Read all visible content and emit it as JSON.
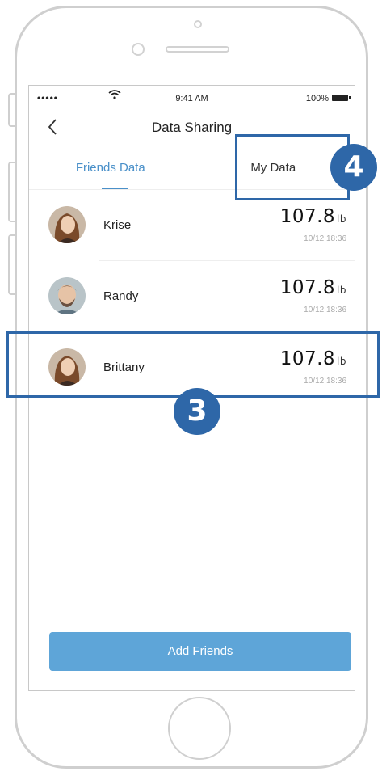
{
  "status_bar": {
    "signal": "•••••",
    "wifi": "wifi-icon",
    "time": "9:41 AM",
    "battery": "100%"
  },
  "nav": {
    "title": "Data Sharing",
    "back_icon": "chevron-left-icon"
  },
  "tabs": [
    {
      "label": "Friends Data",
      "active": true
    },
    {
      "label": "My Data",
      "active": false
    }
  ],
  "friends": [
    {
      "name": "Krise",
      "weight": "107.8",
      "unit": "lb",
      "timestamp": "10/12 18:36"
    },
    {
      "name": "Randy",
      "weight": "107.8",
      "unit": "lb",
      "timestamp": "10/12 18:36"
    },
    {
      "name": "Brittany",
      "weight": "107.8",
      "unit": "lb",
      "timestamp": "10/12 18:36"
    }
  ],
  "add_button": {
    "label": "Add Friends"
  },
  "annotations": {
    "badge_3": "3",
    "badge_4": "4"
  },
  "colors": {
    "accent": "#4a90c9",
    "button": "#5ea5d8",
    "annotation": "#2e67a8"
  }
}
